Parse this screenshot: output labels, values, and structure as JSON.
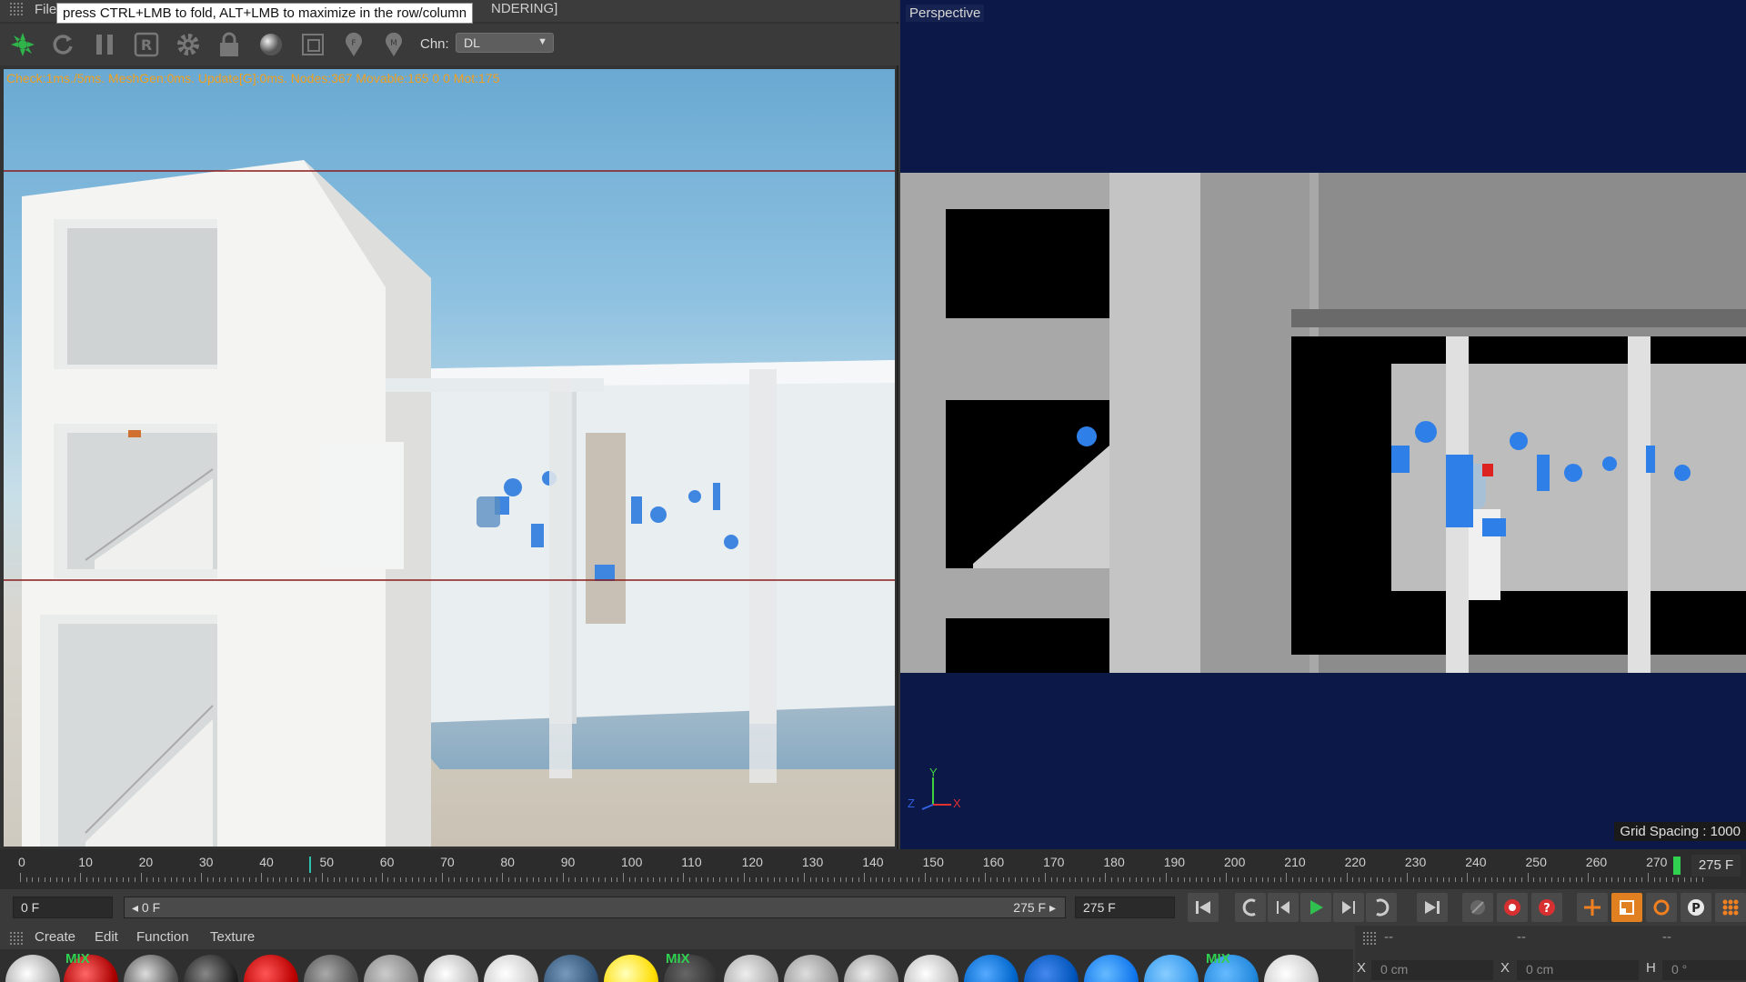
{
  "window": {
    "menu_file": "File",
    "menu_rendering_partial": "NDERING]",
    "tooltip": "press CTRL+LMB to fold, ALT+LMB to maximize in the row/column"
  },
  "toolbar": {
    "buttons": [
      "octane-logo-icon",
      "refresh-icon",
      "pause-icon",
      "r-icon",
      "settings-gear-icon",
      "lock-icon",
      "material-ball-icon",
      "region-icon",
      "focus-pin-icon",
      "material-pin-icon"
    ],
    "chn_label": "Chn:",
    "chn_value": "DL"
  },
  "render": {
    "status": "Check:1ms./5ms. MeshGen:0ms. Update[G]:0ms. Nodes:367 Movable:165  0 0 Mot:175"
  },
  "viewport": {
    "label": "Perspective",
    "grid_spacing": "Grid Spacing : 1000",
    "axis_y": "Y",
    "axis_x": "X",
    "axis_z": "Z"
  },
  "timeline": {
    "ticks": [
      "0",
      "10",
      "20",
      "30",
      "40",
      "50",
      "60",
      "70",
      "80",
      "90",
      "100",
      "110",
      "120",
      "130",
      "140",
      "150",
      "160",
      "170",
      "180",
      "190",
      "200",
      "210",
      "220",
      "230",
      "240",
      "250",
      "260",
      "270"
    ],
    "end_frame": "275 F",
    "current_frame_value": 45
  },
  "transport": {
    "start_field": "0 F",
    "range_start": "◂ 0 F",
    "range_end": "275 F ▸",
    "end_field": "275 F"
  },
  "materials": {
    "menu": [
      "Create",
      "Edit",
      "Function",
      "Texture"
    ],
    "mix_label": "MIX"
  },
  "coords": {
    "header1": "--",
    "header2": "--",
    "header3": "--",
    "x_label": "X",
    "x_value": "0 cm",
    "x2_label": "X",
    "x2_value": "0 cm",
    "h_label": "H",
    "h_value": "0 °"
  },
  "colors": {
    "status_text": "#f0a020",
    "viewport_bg": "#0c1848",
    "play_green": "#30c050",
    "keyframe_green": "#30d050"
  }
}
